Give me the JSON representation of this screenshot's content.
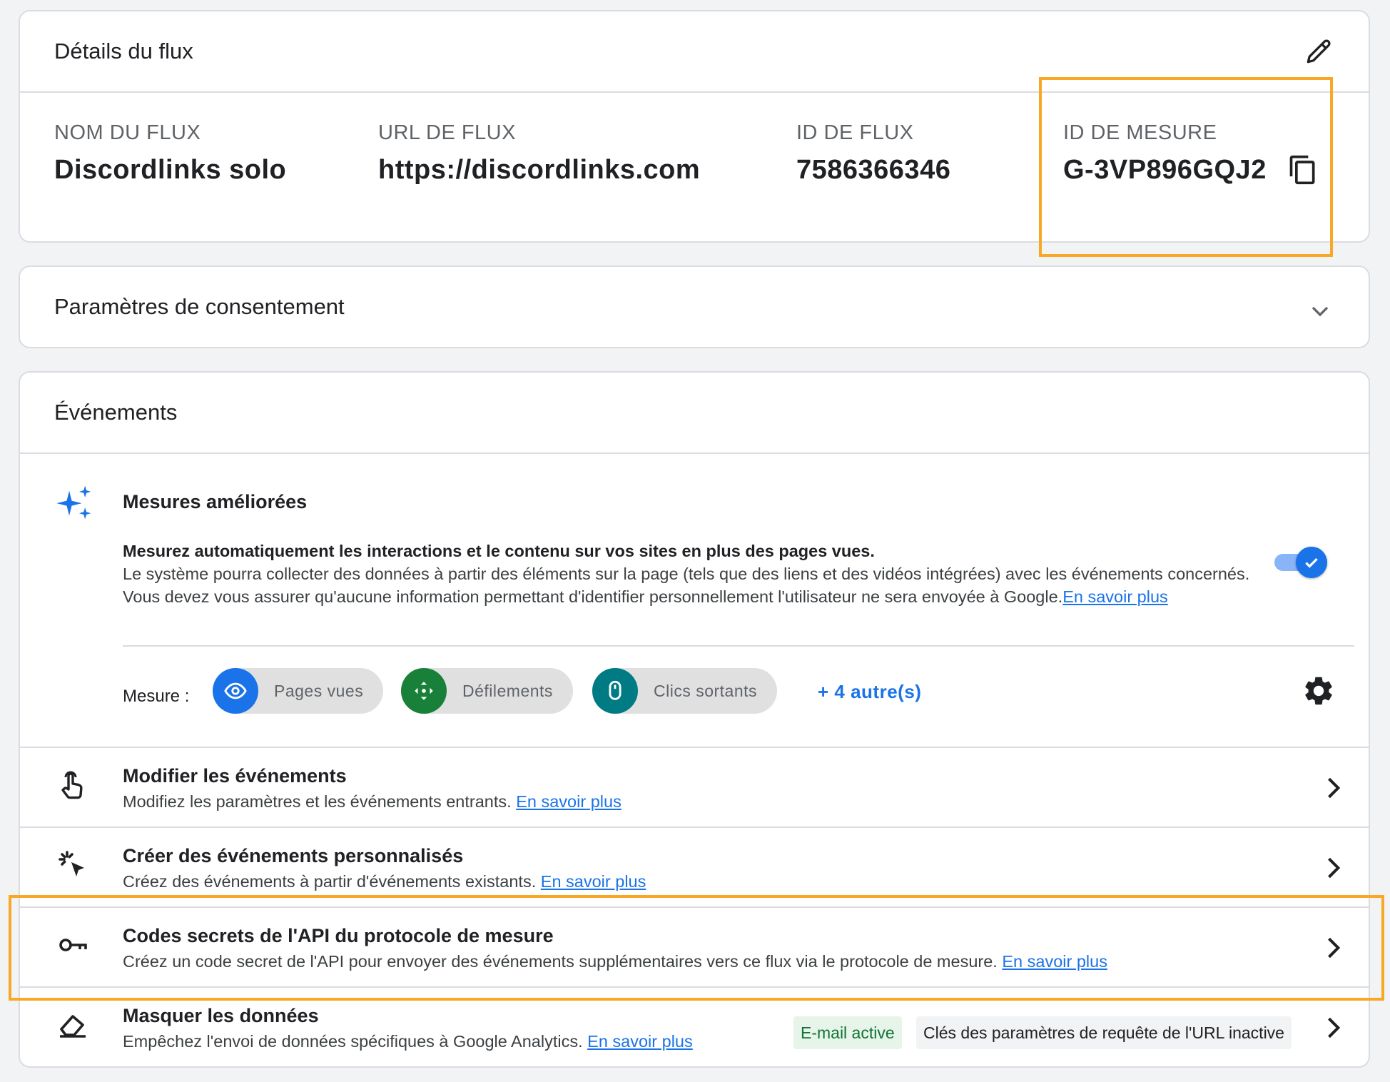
{
  "details": {
    "title": "Détails du flux",
    "fields": [
      {
        "label": "NOM DU FLUX",
        "value": "Discordlinks solo"
      },
      {
        "label": "URL DE FLUX",
        "value": "https://discordlinks.com"
      },
      {
        "label": "ID DE FLUX",
        "value": "7586366346"
      },
      {
        "label": "ID DE MESURE",
        "value": "G-3VP896GQJ2"
      }
    ]
  },
  "consent": {
    "title": "Paramètres de consentement"
  },
  "events": {
    "title": "Événements",
    "enhanced": {
      "title": "Mesures améliorées",
      "desc_bold": "Mesurez automatiquement les interactions et le contenu sur vos sites en plus des pages vues.",
      "desc_text": "Le système pourra collecter des données à partir des éléments sur la page (tels que des liens et des vidéos intégrées) avec les événements concernés. Vous devez vous assurer qu'aucune information permettant d'identifier personnellement l'utilisateur ne sera envoyée à Google.",
      "learn_more": "En savoir plus",
      "toggle_on": true,
      "measure_label": "Mesure :",
      "chips": [
        {
          "label": "Pages vues",
          "icon": "eye-icon",
          "color": "#1a73e8"
        },
        {
          "label": "Défilements",
          "icon": "scroll-icon",
          "color": "#188038"
        },
        {
          "label": "Clics sortants",
          "icon": "mouse-icon",
          "color": "#007b83"
        }
      ],
      "more": "+ 4 autre(s)"
    },
    "rows": [
      {
        "title": "Modifier les événements",
        "subtitle": "Modifiez les paramètres et les événements entrants.",
        "link": "En savoir plus",
        "icon": "touch-icon"
      },
      {
        "title": "Créer des événements personnalisés",
        "subtitle": "Créez des événements à partir d'événements existants.",
        "link": "En savoir plus",
        "icon": "click-icon"
      },
      {
        "title": "Codes secrets de l'API du protocole de mesure",
        "subtitle": "Créez un code secret de l'API pour envoyer des événements supplémentaires vers ce flux via le protocole de mesure.",
        "link": "En savoir plus",
        "icon": "key-icon"
      },
      {
        "title": "Masquer les données",
        "subtitle": "Empêchez l'envoi de données spécifiques à Google Analytics.",
        "link": "En savoir plus",
        "icon": "eraser-icon",
        "badges": [
          "E-mail active",
          "Clés des paramètres de requête de l'URL inactive"
        ]
      }
    ]
  },
  "colors": {
    "accent": "#1a73e8",
    "highlight": "#f9a825",
    "green": "#188038",
    "teal": "#007b83"
  }
}
